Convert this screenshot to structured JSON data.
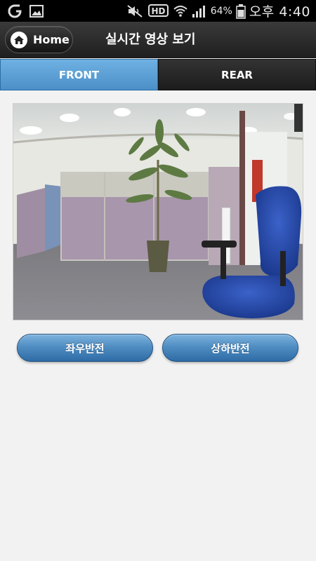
{
  "status_bar": {
    "battery_percent": "64%",
    "time": "오후 4:40",
    "icons": [
      "carrier-logo-icon",
      "gallery-icon",
      "mute-icon",
      "hd-voice-icon",
      "wifi-icon",
      "signal-icon",
      "battery-icon"
    ],
    "hd_label": "HD"
  },
  "header": {
    "home_label": "Home",
    "title": "실시간 영상 보기"
  },
  "tabs": [
    {
      "label": "FRONT",
      "active": true
    },
    {
      "label": "REAR",
      "active": false
    }
  ],
  "video": {
    "camera": "front-camera-live-view"
  },
  "controls": {
    "flip_horizontal": "좌우반전",
    "flip_vertical": "상하반전"
  },
  "colors": {
    "accent": "#4b8fc8",
    "header_bg": "#1f1f1f",
    "page_bg": "#f2f2f2"
  }
}
